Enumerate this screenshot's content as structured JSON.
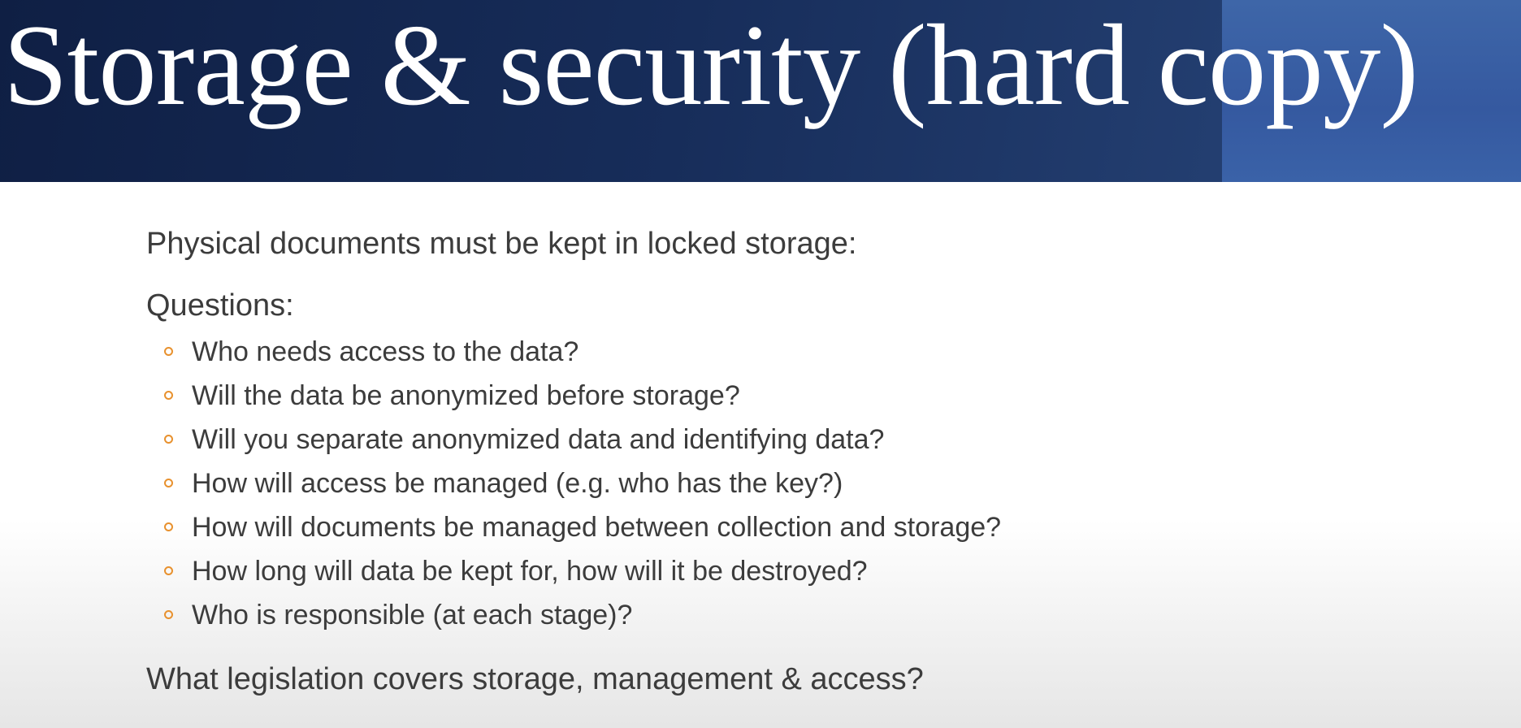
{
  "slide": {
    "title": "Storage & security (hard copy)",
    "intro": "Physical documents must be kept in locked storage:",
    "questions_heading": "Questions:",
    "questions": [
      "Who needs access to the data?",
      "Will the data be anonymized before storage?",
      "Will you separate anonymized data and identifying data?",
      "How will access be managed (e.g. who has the key?)",
      "How will documents be managed between collection and storage?",
      "How long will data be kept for, how will it be destroyed?",
      "Who is responsible (at each stage)?"
    ],
    "closing": "What legislation covers storage, management & access?"
  },
  "colors": {
    "title_band": "#172d5a",
    "title_band_accent": "#3a62a8",
    "title_text": "#ffffff",
    "body_text": "#3c3c3c",
    "bullet": "#e8912e"
  },
  "icons": {
    "bullet": "hollow-circle-bullet-icon"
  }
}
